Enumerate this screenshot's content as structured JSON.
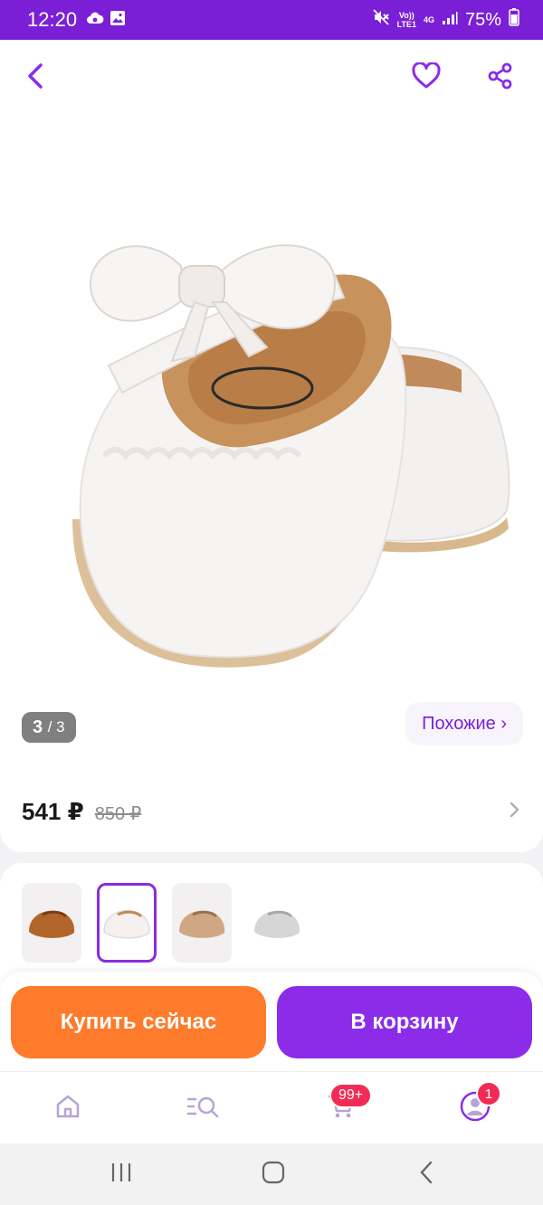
{
  "status_bar": {
    "time": "12:20",
    "network_top": "Vo))",
    "network_bottom": "LTE1",
    "network_type": "4G",
    "battery": "75%"
  },
  "header": {
    "back_icon": "chevron-left-icon",
    "favorite_icon": "heart-outline-icon",
    "share_icon": "share-icon"
  },
  "gallery": {
    "current": "3",
    "total": "/ 3",
    "similar_label": "Похожие ›"
  },
  "pricing": {
    "price": "541 ₽",
    "old_price": "850 ₽"
  },
  "variants": [
    {
      "name": "brown",
      "color": "#b2652b",
      "selected": false
    },
    {
      "name": "white",
      "color": "#f4f1ef",
      "selected": true
    },
    {
      "name": "beige",
      "color": "#cfa784",
      "selected": false
    },
    {
      "name": "grey",
      "color": "#c9c9c9",
      "selected": false
    }
  ],
  "actions": {
    "buy_now": "Купить сейчас",
    "add_to_cart": "В корзину"
  },
  "bottom_nav": {
    "items": [
      "home-icon",
      "catalog-search-icon",
      "cart-icon",
      "profile-icon"
    ],
    "cart_badge": "99+",
    "profile_badge": "1"
  },
  "colors": {
    "brand_purple": "#7b1fd6",
    "buy_orange": "#fd7b2a",
    "cart_purple": "#8b2ce8",
    "badge_red": "#f02c56"
  }
}
